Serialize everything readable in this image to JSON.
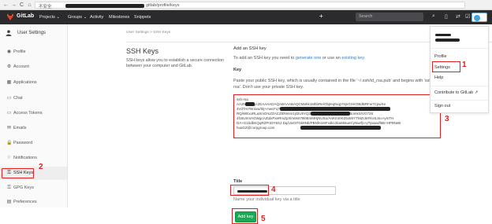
{
  "browser": {
    "address_prefix": "不安全",
    "address_suffix": "gitlab/profile/keys",
    "nav": [
      "←",
      "→",
      "C",
      "⌂"
    ]
  },
  "topbar": {
    "brand": "GitLab",
    "menu": [
      "Projects ⌄",
      "Groups ⌄",
      "Activity",
      "Milestones",
      "Snippets"
    ],
    "search_placeholder": "Search",
    "icons": [
      "search-icon",
      "issues-icon",
      "merge-request-icon",
      "todos-icon"
    ]
  },
  "sidebar": {
    "header": "User Settings",
    "items": [
      {
        "label": "Profile",
        "icon": "◉"
      },
      {
        "label": "Account",
        "icon": "⚙"
      },
      {
        "label": "Applications",
        "icon": "▦"
      },
      {
        "label": "Chat",
        "icon": "▭"
      },
      {
        "label": "Access Tokens",
        "icon": "▭"
      },
      {
        "label": "Emails",
        "icon": "✉"
      },
      {
        "label": "Password",
        "icon": "🔒"
      },
      {
        "label": "Notifications",
        "icon": "♢"
      },
      {
        "label": "SSH Keys",
        "icon": "⚿"
      },
      {
        "label": "GPG Keys",
        "icon": "⚿"
      },
      {
        "label": "Preferences",
        "icon": "▤"
      }
    ],
    "active_index": 8
  },
  "page": {
    "breadcrumb": "User Settings > SSH Keys",
    "title": "SSH Keys",
    "description": "SSH keys allow you to establish a secure connection between your computer and GitLab.",
    "add_heading": "Add an SSH key",
    "add_text_before": "To add an SSH key you need to ",
    "generate_link": "generate one",
    "add_text_middle": " or use an ",
    "existing_link": "existing key",
    "key_label": "Key",
    "key_help": "Paste your public SSH key, which is usually contained in the file '~/.ssh/id_rsa.pub' and begins with 'ssh-rsa'. Don't use your private SSH key.",
    "key_lines": [
      "ssh-rsa",
      "AA3NzaC1yc2EAAAADAQABAAABAQCMahk1MbbRe/ObjteqNxgY9jnGXKOBdBRFw7CpwXe",
      "4VdTAt7Bnlow/t0j+mwcFqTbr4FF7inuoIngA+uLTiUhoiBz+kIvJFGGmSY9Nt+1+60ZBFTN",
      "RQ/WExoRLaSmOmZZACZt0Nmm1jGlU5YQ3z/9o15tNpzy5R3zJGGGlBomkS/VG728",
      "4fc8UmVAGWgcAZtdxPxeRmZpXlmMvt79l08mMHjNUSo/AnKmmKZ6xMrYTMZc5IFKsSJno+ymTH",
      "DA+G1bdbKQqRZPnt3Y6SJ.Dq/Uiv0I7Gk8Nb/PBNfe1I6Fxdkc2ka6k6ueCyNwrfp+yTywwufl6B+HP8NeB",
      "huaGZ@corpgroup.com"
    ],
    "title_label": "Title",
    "title_help": "Name your individual key via a title",
    "add_button": "Add key"
  },
  "dropdown": {
    "items": [
      "Profile",
      "Settings",
      "Help",
      "Contribute to GitLab",
      "Sign out"
    ]
  },
  "annotations": [
    "1",
    "2",
    "3",
    "4",
    "5"
  ],
  "colors": {
    "topbar": "#2b2a2d",
    "accent_red": "#e02020",
    "link_blue": "#2e80c6",
    "button_green": "#1aaa55"
  }
}
